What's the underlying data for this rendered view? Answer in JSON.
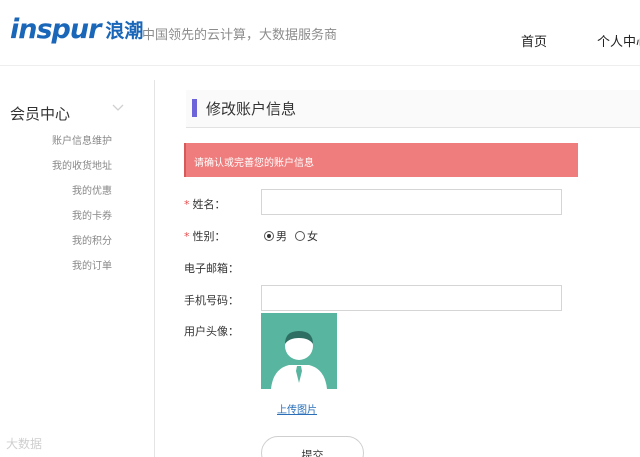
{
  "header": {
    "logo_en": "inspur",
    "logo_cn": "浪潮",
    "slogan": "中国领先的云计算，大数据服务商",
    "nav_home": "首页",
    "nav_user": "个人中心"
  },
  "sidebar": {
    "title": "会员中心",
    "items": [
      "账户信息维护",
      "我的收货地址",
      "我的优惠",
      "我的卡券",
      "我的积分",
      "我的订单"
    ]
  },
  "main": {
    "title": "修改账户信息",
    "alert": "请确认或完善您的账户信息",
    "form": {
      "name_label": "姓名：",
      "name_value": "",
      "gender_label": "性别：",
      "gender_options": [
        "男",
        "女"
      ],
      "gender_selected": "男",
      "email_label": "电子邮箱：",
      "phone_label": "手机号码：",
      "phone_value": "",
      "avatar_label": "用户头像：",
      "upload_link": "上传图片",
      "submit": "提交"
    }
  },
  "colors": {
    "brand": "#1a66b8",
    "title_bar": "#6c64d8",
    "alert_bg": "#ef7d7d",
    "avatar_bg": "#58b6a0"
  },
  "watermark": "大数据"
}
